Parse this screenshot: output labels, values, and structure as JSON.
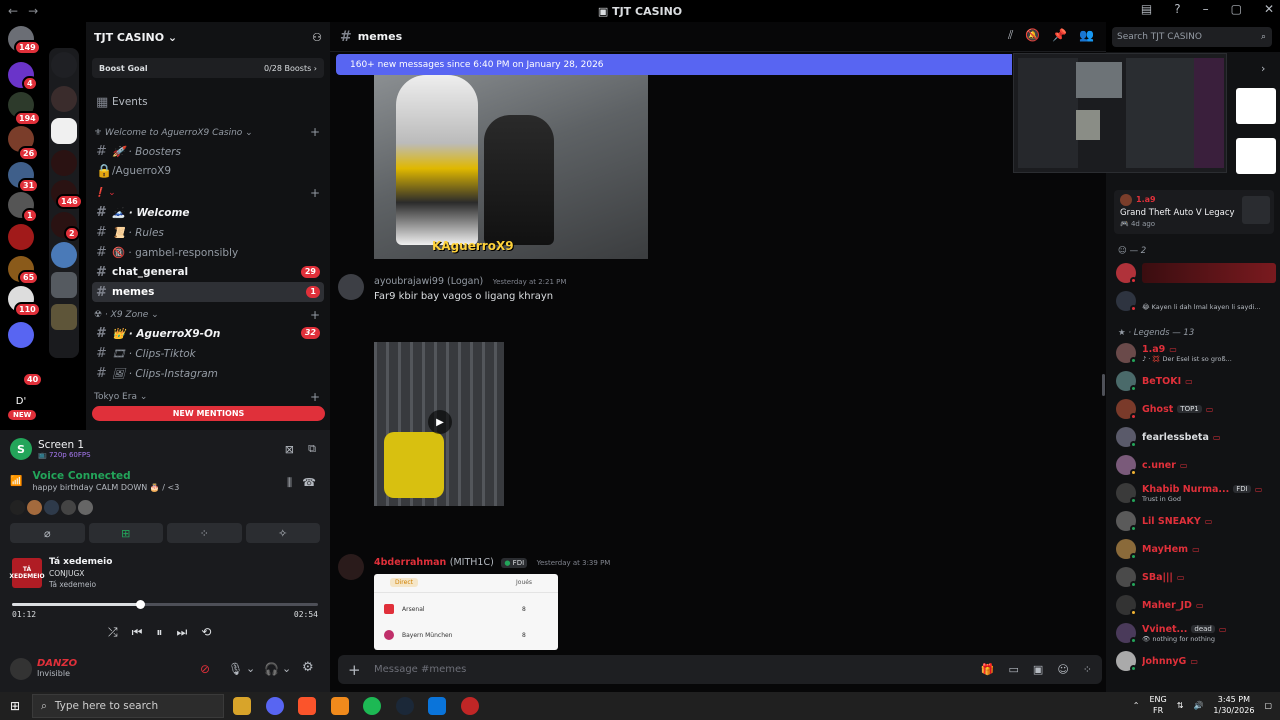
{
  "window": {
    "title": "TJT CASINO",
    "back": "←",
    "forward": "→"
  },
  "server_badges": [
    "149",
    "4",
    "194",
    "26",
    "31",
    "1",
    "146",
    "2",
    "65",
    "110",
    "40"
  ],
  "server_labels": {
    "dm": "D'",
    "new": "NEW"
  },
  "guild": {
    "name": "TJT CASINO ⌄",
    "boost_goal": "Boost Goal",
    "boost_count": "0/28 Boosts ›",
    "events": "Events",
    "categories": [
      {
        "label": "⚜ Welcome to AguerroX9 Casino ⌄"
      },
      {
        "label": "❗ ⌄"
      },
      {
        "label": "☢ · X9 Zone ⌄"
      },
      {
        "label": "Tokyo Era ⌄"
      }
    ],
    "channels": [
      {
        "label": "🚀 · Boosters",
        "style": "italic"
      },
      {
        "label": "/AguerroX9",
        "style": ""
      },
      {
        "label": "🗻 · Welcome",
        "style": "bold-italic"
      },
      {
        "label": "📜 · Rules",
        "style": "italic"
      },
      {
        "label": "🔞 · gambel-responsibly",
        "style": ""
      },
      {
        "label": "chat_general",
        "style": "bold",
        "badge": "29"
      },
      {
        "label": "memes",
        "style": "active",
        "badge": "1"
      },
      {
        "label": "👑 · AguerroX9-On",
        "style": "bold-italic",
        "badge": "32"
      },
      {
        "label": "🎞 · Clips-Tiktok",
        "style": "italic"
      },
      {
        "label": "🖼 · Clips-Instagram",
        "style": "italic"
      }
    ],
    "new_mentions": "NEW MENTIONS"
  },
  "stream": {
    "title": "Screen 1",
    "quality": "📺 720p 60FPS"
  },
  "voice": {
    "status": "Voice Connected",
    "channel": "happy birthday CALM DOWN 🎂 / <3"
  },
  "music": {
    "art_label": "TÁ XEDEMEIO",
    "title": "Tá xedemeio",
    "artist": "CONJUGX",
    "album": "Tá xedemeio",
    "elapsed": "01:12",
    "duration": "02:54",
    "progress": 0.418
  },
  "user": {
    "name": "DANZO",
    "status": "Invisible"
  },
  "chat": {
    "channel": "memes",
    "new_banner": "160+ new messages since 6:40 PM on January 28, 2026",
    "watermark": "KAguerroX9",
    "messages": [
      {
        "author": "ayoubrajawi99 (Logan)",
        "time": "Yesterday at 2:21 PM",
        "text": "Far9 kbir bay vagos o ligang khrayn"
      },
      {
        "author": "4bderrahman",
        "author2": "(MITH1C)",
        "tag": "FDI",
        "time": "Yesterday at 3:39 PM"
      }
    ],
    "table_header": "Direct",
    "table_col": "Joués",
    "table_rows": [
      {
        "team": "Arsenal",
        "val": "8"
      },
      {
        "team": "Bayern München",
        "val": "8"
      }
    ],
    "composer_placeholder": "Message #memes"
  },
  "search": {
    "placeholder": "Search TJT CASINO"
  },
  "members": {
    "top_activity": {
      "name": "1.a9",
      "game": "Grand Theft Auto V Legacy",
      "time": "🎮 4d ago"
    },
    "group_label": "☺ — 2",
    "group2_status": "😂 Kayen li dah lmal kayen li saydi...",
    "legends_label": "★ · Legends — 13",
    "list": [
      {
        "name": "1.a9",
        "sub": "♪ · 💢 Der Esel ist so groß...",
        "color": "#e0303a"
      },
      {
        "name": "BeTOKI",
        "sub": "",
        "color": "#e0303a"
      },
      {
        "name": "Ghost",
        "sub": "",
        "tag": "TOP1",
        "color": "#e0303a"
      },
      {
        "name": "fearlessbeta",
        "sub": "",
        "color": "#dbdee1"
      },
      {
        "name": "c.uner",
        "sub": "",
        "color": "#e0303a"
      },
      {
        "name": "Khabib Nurma...",
        "sub": "Trust in God",
        "tag": "FDI",
        "color": "#e0303a"
      },
      {
        "name": "Lil SNEAKY",
        "sub": "",
        "color": "#e0303a"
      },
      {
        "name": "MayHem",
        "sub": "",
        "color": "#e0303a"
      },
      {
        "name": "SBa|||",
        "sub": "",
        "color": "#e0303a"
      },
      {
        "name": "Maher_JD",
        "sub": "",
        "color": "#e0303a"
      },
      {
        "name": "Vvinet...",
        "sub": "👁 nothing for nothing",
        "tag": "dead",
        "color": "#e0303a"
      },
      {
        "name": "JohnnyG",
        "sub": "",
        "color": "#e0303a"
      }
    ]
  },
  "taskbar": {
    "search": "Type here to search",
    "lang": "ENG",
    "region": "FR",
    "time": "3:45 PM",
    "date": "1/30/2026"
  },
  "colors": {
    "accent": "#5865f2",
    "danger": "#e0303a",
    "online": "#23a55a"
  }
}
